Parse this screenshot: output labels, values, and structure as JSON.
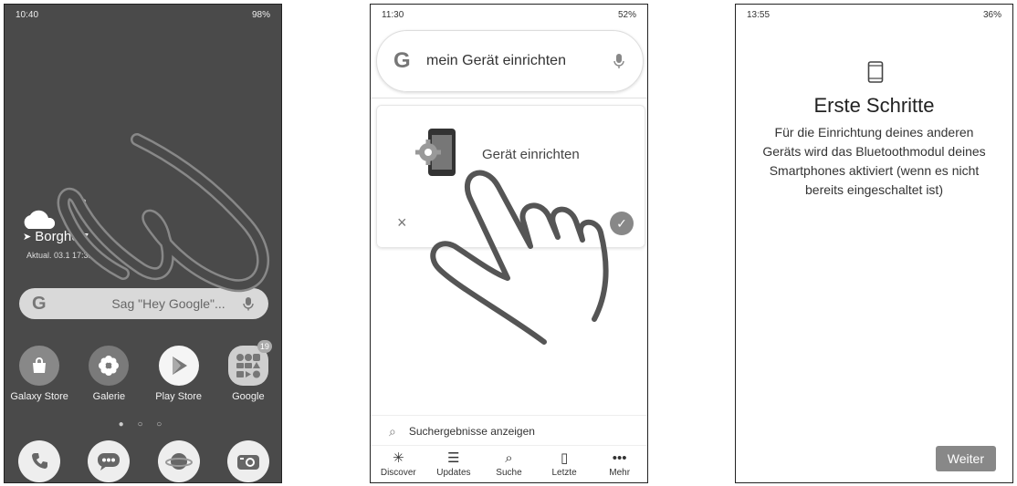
{
  "phone1": {
    "status_time": "10:40",
    "status_right": "98%",
    "weather_temp_unit": "°",
    "location": "Borgholz",
    "updated": "Aktual. 03.1 17:32",
    "google_bar_hint": "Sag \"Hey Google\"...",
    "apps": [
      {
        "label": "Galaxy Store",
        "icon": "bag-icon"
      },
      {
        "label": "Galerie",
        "icon": "flower-icon"
      },
      {
        "label": "Play Store",
        "icon": "play-icon"
      },
      {
        "label": "Google",
        "icon": "folder-icon",
        "badge": "19"
      }
    ],
    "page_dots": "● ○ ○",
    "dock": [
      {
        "icon": "phone-icon"
      },
      {
        "icon": "messages-icon"
      },
      {
        "icon": "browser-icon"
      },
      {
        "icon": "camera-icon"
      }
    ]
  },
  "phone2": {
    "status_time": "11:30",
    "status_right": "52%",
    "search_query": "mein Gerät einrichten",
    "card_title": "Gerät einrichten",
    "dismiss_symbol": "×",
    "confirm_symbol": "✓",
    "search_results_label": "Suchergebnisse anzeigen",
    "nav": [
      {
        "label": "Discover",
        "icon": "✳"
      },
      {
        "label": "Updates",
        "icon": "☰"
      },
      {
        "label": "Suche",
        "icon": "⌕"
      },
      {
        "label": "Letzte",
        "icon": "▯"
      },
      {
        "label": "Mehr",
        "icon": "•••"
      }
    ]
  },
  "phone3": {
    "status_time": "13:55",
    "status_right": "36%",
    "title": "Erste Schritte",
    "body": "Für die Einrichtung deines anderen Geräts wird das Bluetoothmodul deines Smartphones aktiviert (wenn es nicht bereits eingeschaltet ist)",
    "next_button": "Weiter"
  }
}
